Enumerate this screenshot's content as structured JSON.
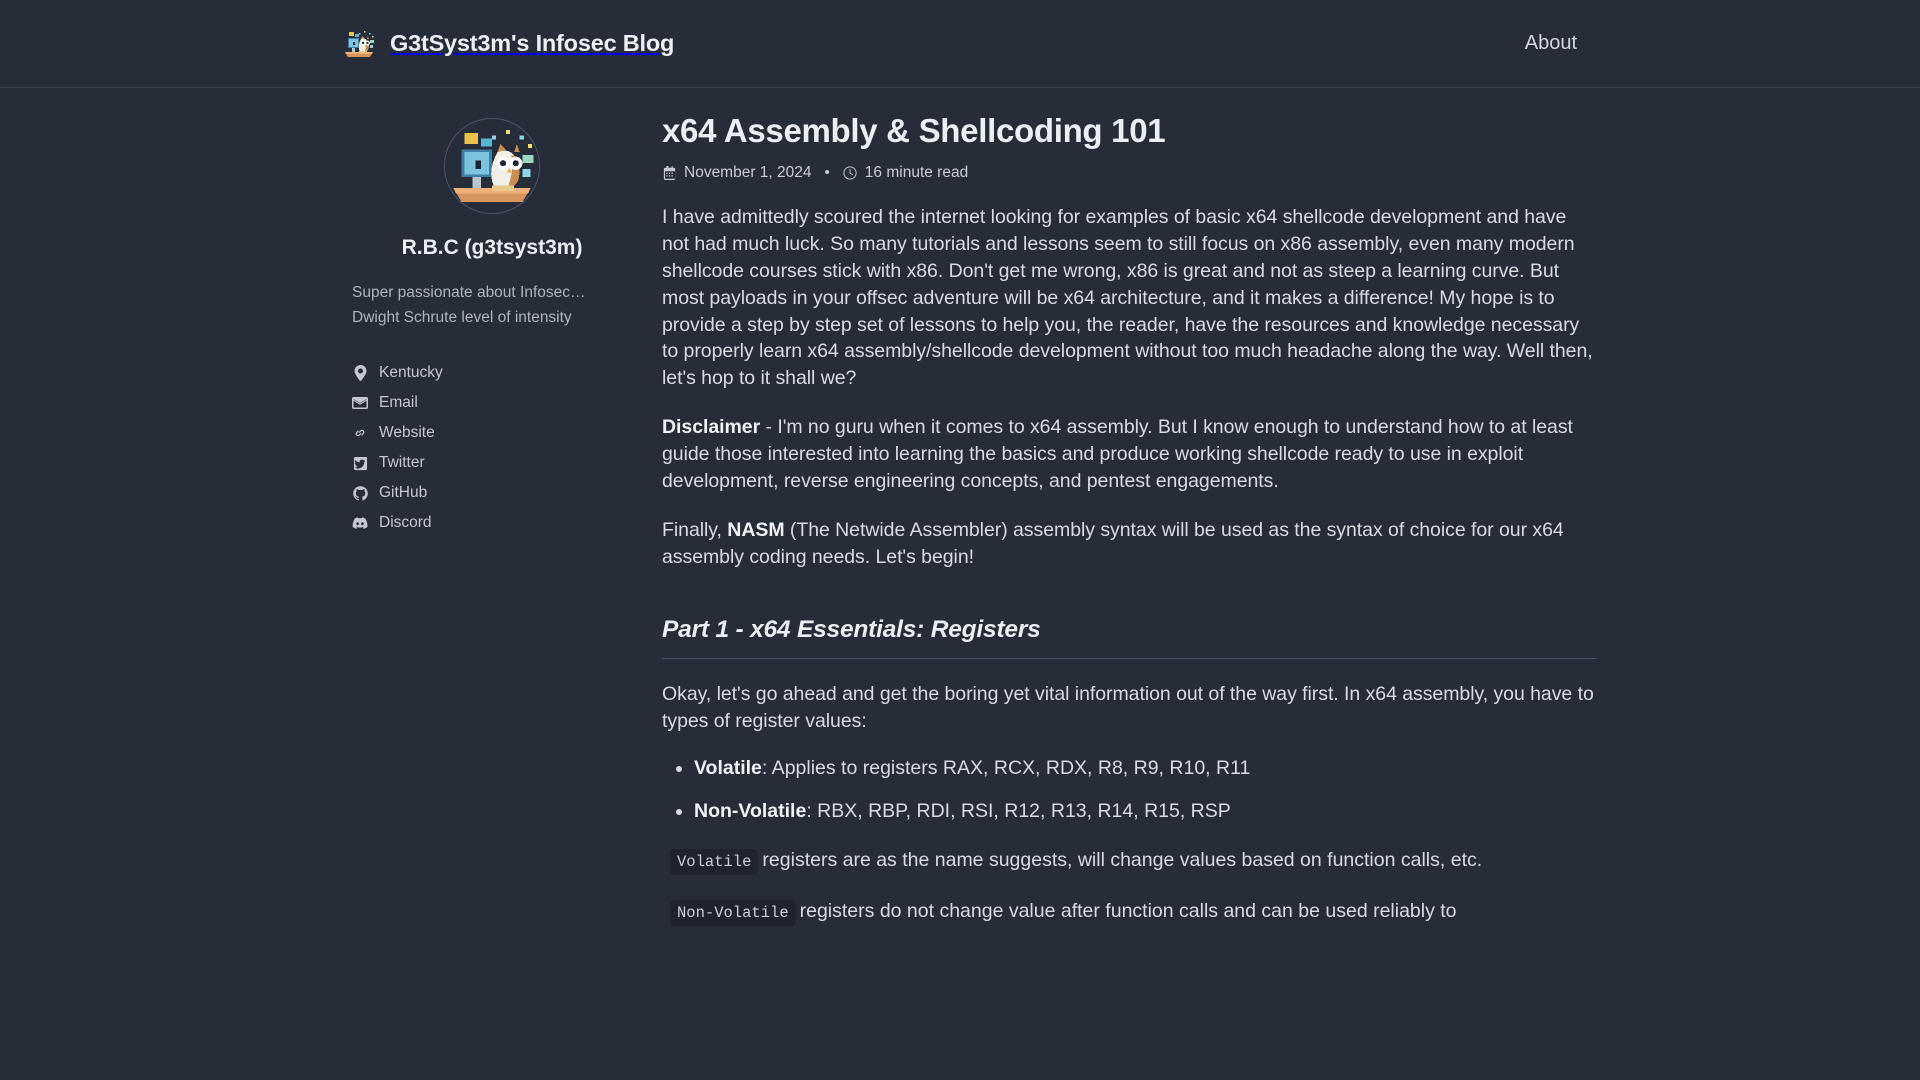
{
  "header": {
    "logo_icon": "owl-computer-logo-icon",
    "title": "G3tSyst3m's Infosec Blog",
    "nav": [
      {
        "label": "About",
        "name": "nav-link-about"
      }
    ]
  },
  "sidebar": {
    "avatar_icon": "owl-avatar-image",
    "author_name": "R.B.C (g3tsyst3m)",
    "bio_lines": [
      "Super passionate about Infosec…",
      "Dwight Schrute level of intensity"
    ],
    "social": [
      {
        "label": "Kentucky",
        "icon": "location-pin-icon",
        "name": "sidebar-item-location"
      },
      {
        "label": "Email",
        "icon": "envelope-icon",
        "name": "sidebar-item-email"
      },
      {
        "label": "Website",
        "icon": "link-chain-icon",
        "name": "sidebar-item-website"
      },
      {
        "label": "Twitter",
        "icon": "twitter-icon",
        "name": "sidebar-item-twitter"
      },
      {
        "label": "GitHub",
        "icon": "github-icon",
        "name": "sidebar-item-github"
      },
      {
        "label": "Discord",
        "icon": "discord-icon",
        "name": "sidebar-item-discord"
      }
    ]
  },
  "post": {
    "title": "x64 Assembly & Shellcoding 101",
    "date": "November 1, 2024",
    "date_icon": "calendar-icon",
    "meta_separator": "•",
    "read_time": "16 minute read",
    "read_time_icon": "clock-icon",
    "paragraph_1": "I have admittedly scoured the internet looking for examples of basic x64 shellcode development and have not had much luck. So many tutorials and lessons seem to still focus on x86 assembly, even many modern shellcode courses stick with x86. Don't get me wrong, x86 is great and not as steep a learning curve. But most payloads in your offsec adventure will be x64 architecture, and it makes a difference! My hope is to provide a step by step set of lessons to help you, the reader, have the resources and knowledge necessary to properly learn x64 assembly/shellcode development without too much headache along the way. Well then, let's hop to it shall we?",
    "disclaimer_label": "Disclaimer",
    "disclaimer_text": " - I'm no guru when it comes to x64 assembly. But I know enough to understand how to at least guide those interested into learning the basics and produce working shellcode ready to use in exploit development, reverse engineering concepts, and pentest engagements.",
    "finally_prefix": "Finally, ",
    "finally_bold": "NASM",
    "finally_suffix": " (The Netwide Assembler) assembly syntax will be used as the syntax of choice for our x64 assembly coding needs. Let's begin! \u0001",
    "section_1_heading": "Part 1 - x64 Essentials: Registers",
    "section_1_intro": "Okay, let's go ahead and get the boring yet vital information out of the way first. In x64 assembly, you have to types of register values:",
    "bullets": [
      {
        "bold": "Volatile",
        "text": ": Applies to registers RAX, RCX, RDX, R8, R9, R10, R11"
      },
      {
        "bold": "Non-Volatile",
        "text": ": RBX, RBP, RDI, RSI, R12, R13, R14, R15, RSP"
      }
    ],
    "code_note_1_code": "Volatile",
    "code_note_1_text": "registers are as the name suggests, will change values based on function calls, etc.",
    "code_note_2_code": "Non-Volatile",
    "code_note_2_text": "registers do not change value after function calls and can be used reliably to"
  },
  "colors": {
    "background": "#272c39",
    "text": "#d7dbe2",
    "heading": "#eceff4",
    "muted": "#aeb4c0",
    "border": "#3a4050",
    "code_bg": "#1f2330"
  }
}
